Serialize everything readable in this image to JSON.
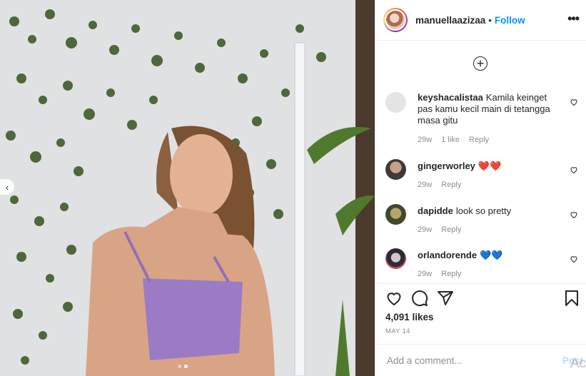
{
  "post": {
    "username": "manuellaazizaa",
    "separator": "•",
    "follow_label": "Follow",
    "more_label": "•••",
    "load_more_label": "+",
    "comments": [
      {
        "user": "keyshacalistaa",
        "text": "Kamila keinget pas kamu kecil main di tetangga masa gitu",
        "time": "29w",
        "likes": "1 like",
        "reply": "Reply"
      },
      {
        "user": "gingerworley",
        "text": "❤️❤️",
        "time": "29w",
        "reply": "Reply"
      },
      {
        "user": "dapidde",
        "text": "look so pretty",
        "time": "29w",
        "reply": "Reply"
      },
      {
        "user": "orlandorende",
        "text": "💙💙",
        "time": "29w",
        "reply": "Reply"
      }
    ],
    "likes": "4,091 likes",
    "date": "MAY 14",
    "add_comment_placeholder": "Add a comment...",
    "post_label": "Post",
    "watermark": "Ac",
    "prev_label": "‹"
  },
  "colors": {
    "link_blue": "#0095f6",
    "post_disabled": "#b2dffc",
    "top_purple": "#9b7cc4"
  },
  "icons": [
    "heart-icon",
    "comment-icon",
    "share-icon",
    "bookmark-icon",
    "plus-circle-icon",
    "more-icon"
  ]
}
